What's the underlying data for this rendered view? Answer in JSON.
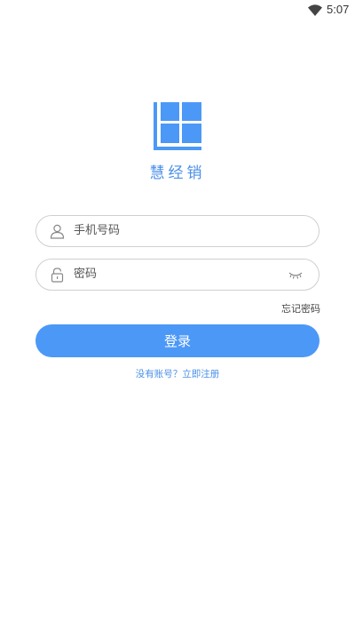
{
  "status_bar": {
    "time": "5:07",
    "wifi_icon": "wifi-icon"
  },
  "app": {
    "name": "慧经销",
    "logo_icon": "grid-logo-icon",
    "brand_color": "#4c98f7"
  },
  "form": {
    "phone": {
      "placeholder": "手机号码",
      "value": "",
      "icon": "user-icon"
    },
    "password": {
      "placeholder": "密码",
      "value": "",
      "icon": "lock-icon",
      "toggle_icon": "eye-closed-icon"
    },
    "forgot_label": "忘记密码",
    "login_label": "登录",
    "register_label": "没有账号？立即注册"
  }
}
